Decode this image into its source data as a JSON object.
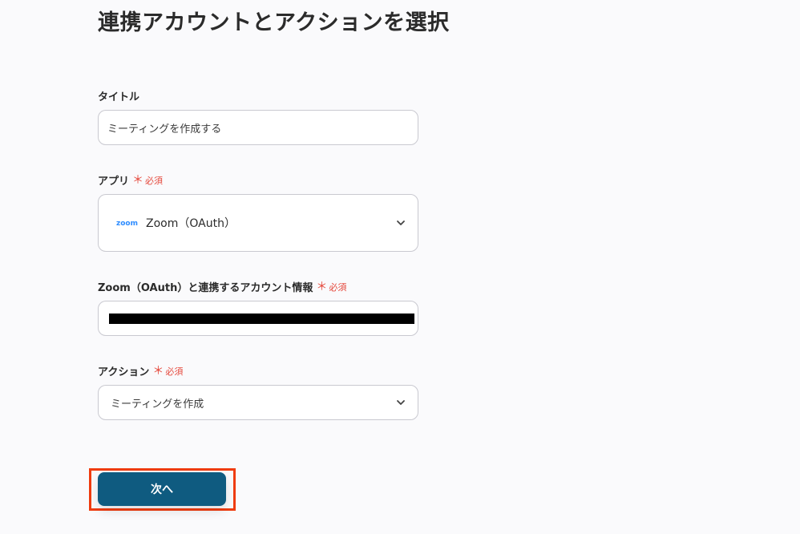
{
  "page_title": "連携アカウントとアクションを選択",
  "required_mark": "＊",
  "title_field": {
    "label": "タイトル",
    "value": "ミーティングを作成する"
  },
  "app_field": {
    "label": "アプリ",
    "required_text": "必須",
    "logo_text": "zoom",
    "value": "Zoom（OAuth）",
    "icon": "chevron-down-icon"
  },
  "account_field": {
    "label": "Zoom（OAuth）と連携するアカウント情報",
    "required_text": "必須"
  },
  "action_field": {
    "label": "アクション",
    "required_text": "必須",
    "value": "ミーティングを作成",
    "icon": "chevron-down-icon"
  },
  "next_button": {
    "label": "次へ"
  },
  "colors": {
    "accent": "#0f5b80",
    "required": "#e5483c",
    "highlight": "#f03c0f",
    "zoom_brand": "#2d8cff"
  }
}
